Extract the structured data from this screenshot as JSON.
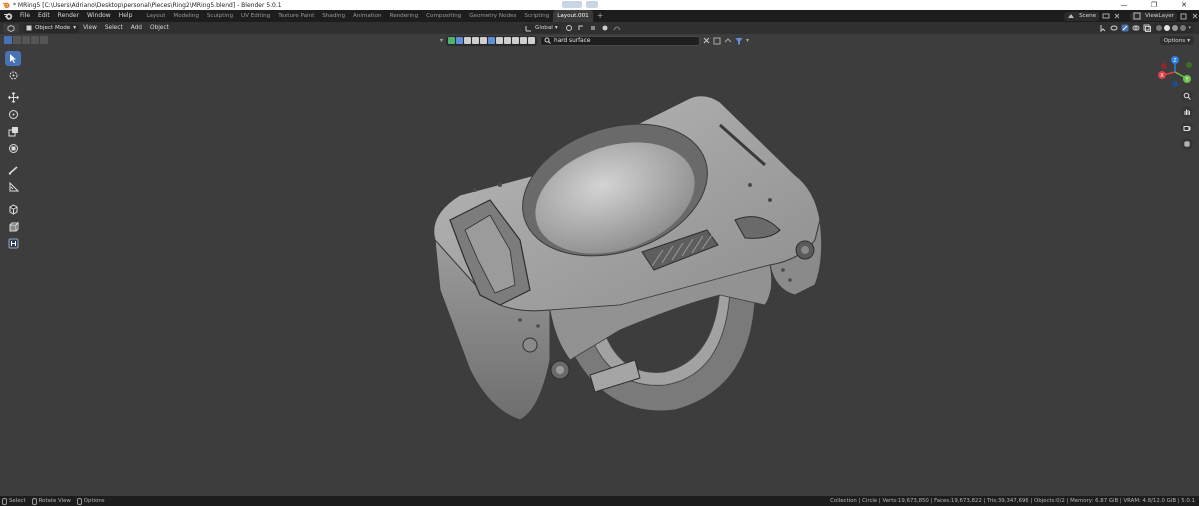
{
  "window": {
    "title": "* MRing5 [C:\\Users\\Adriano\\Desktop\\personal\\Pieces\\Ring2\\MRing5.blend] - Blender 5.0.1",
    "controls": [
      "—",
      "❐",
      "✕"
    ]
  },
  "menus": [
    "File",
    "Edit",
    "Render",
    "Window",
    "Help"
  ],
  "workspaces": [
    "Layout",
    "Modeling",
    "Sculpting",
    "UV Editing",
    "Texture Paint",
    "Shading",
    "Animation",
    "Rendering",
    "Compositing",
    "Geometry Nodes",
    "Scripting",
    "Layout.001"
  ],
  "active_workspace": "Layout.001",
  "topbar_right": {
    "scene_label": "Scene",
    "view_layer_label": "ViewLayer"
  },
  "viewport_header": {
    "mode": "Object Mode",
    "menus": [
      "View",
      "Select",
      "Add",
      "Object"
    ],
    "orientation": "Global",
    "options_label": "Options"
  },
  "filter": {
    "search_value": "hard surface"
  },
  "gizmo": {
    "axes": [
      {
        "label": "Z",
        "color": "#2b7fe0"
      },
      {
        "label": "Y",
        "color": "#6cc24a"
      },
      {
        "label": "X",
        "color": "#e0424d"
      }
    ]
  },
  "status": {
    "hints": [
      "Select",
      "Rotate View",
      "Options"
    ],
    "stats": "Collection | Circle | Verts:19,673,850 | Faces:19,673,822 | Tris:39,347,696 | Objects:0/2 | Memory: 6.87 GiB | VRAM: 4.8/12.0 GiB | 5.0.1"
  },
  "colors": {
    "viewport_bg": "#3d3d3d",
    "accent": "#4772b3",
    "header_bg": "#303030",
    "topbar_bg": "#1d1d1d"
  },
  "icons": {
    "tools": [
      "select-box-icon",
      "cursor-icon",
      "move-icon",
      "rotate-icon",
      "scale-icon",
      "transform-icon",
      "annotate-icon",
      "measure-icon",
      "add-cube-icon",
      "extrude-icon",
      "hard-ops-icon"
    ],
    "nav": [
      "zoom-icon",
      "pan-hand-icon",
      "camera-icon",
      "grid-icon"
    ]
  }
}
